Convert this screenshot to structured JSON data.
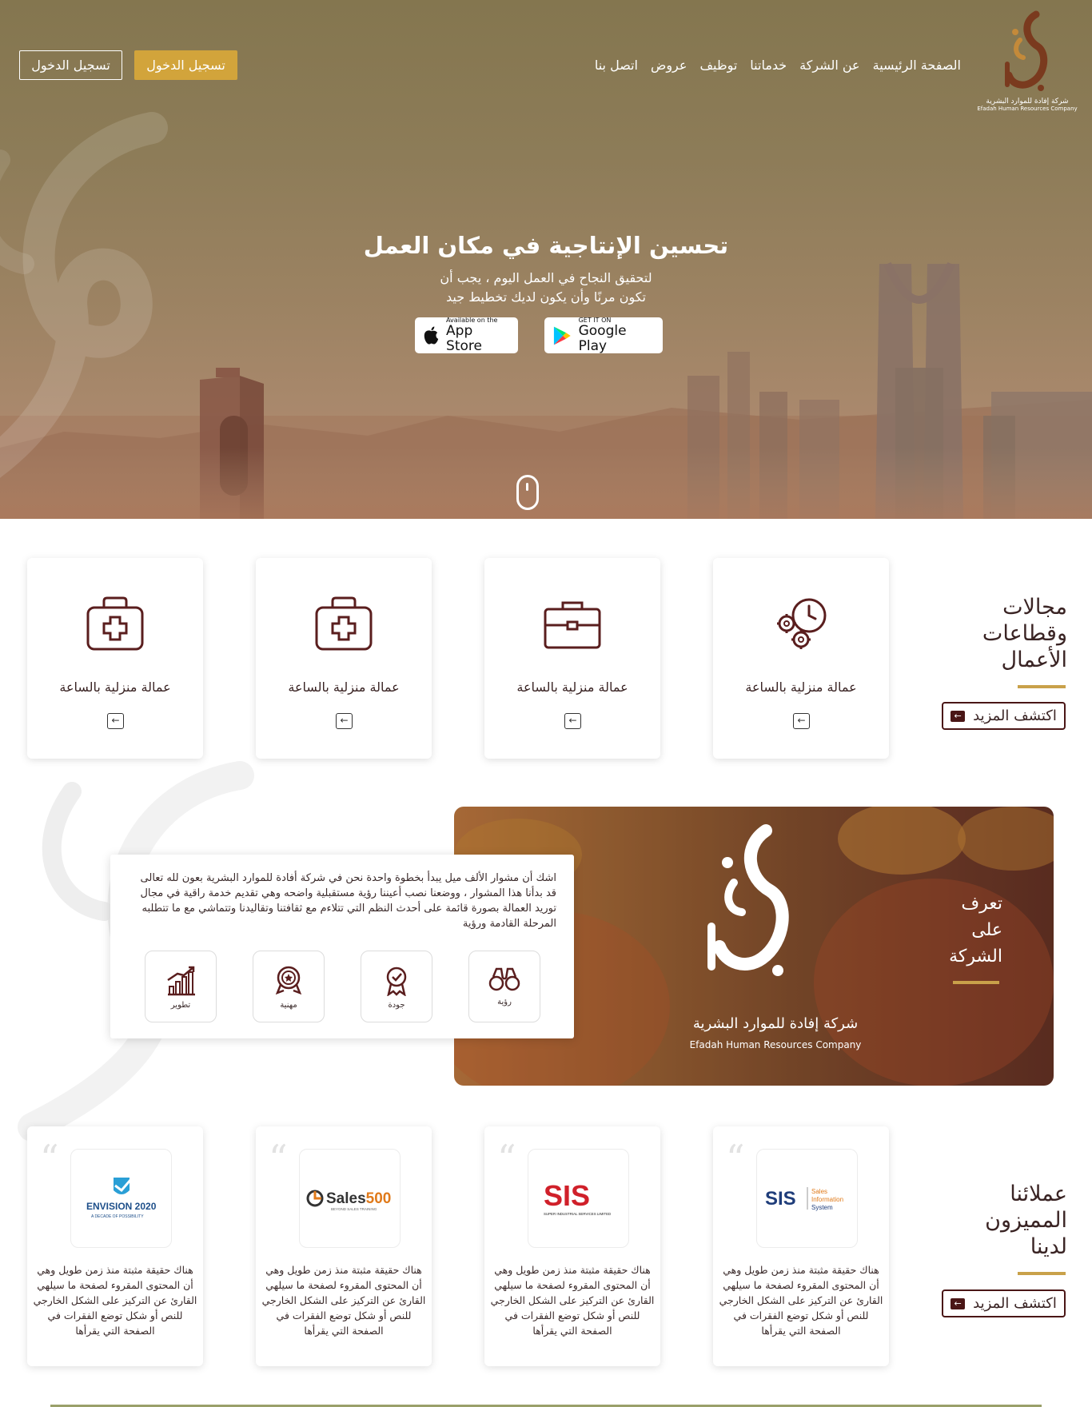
{
  "brand": {
    "logo_mark": "إفادة",
    "name_ar": "شركة إفادة للموارد البشرية",
    "name_en": "Efadah Human Resources Company"
  },
  "nav": {
    "items": [
      "الصفحة الرئيسية",
      "عن الشركة",
      "خدماتنا",
      "توظيف",
      "عروض",
      "اتصل بنا"
    ]
  },
  "auth": {
    "login_primary": "تسجيل الدخول",
    "login_secondary": "تسجيل الدخول"
  },
  "hero": {
    "title": "تحسين الإنتاجية في مكان العمل",
    "subtitle_line1": "لتحقيق النجاح في العمل اليوم ، يجب أن",
    "subtitle_line2": "تكون مرنًا وأن يكون لديك تخطيط جيد",
    "appstore_small": "Available on the",
    "appstore_big": "App Store",
    "googleplay_small": "GET IT ON",
    "googleplay_big": "Google Play"
  },
  "sectors": {
    "title_line1": "مجالات",
    "title_line2": "وقطاعات",
    "title_line3": "الأعمال",
    "more": "اكتشف المزيد",
    "cards": [
      {
        "label": "عمالة منزلية بالساعة",
        "icon": "gears-clock-icon"
      },
      {
        "label": "عمالة منزلية بالساعة",
        "icon": "briefcase-icon"
      },
      {
        "label": "عمالة منزلية بالساعة",
        "icon": "medical-kit-icon"
      },
      {
        "label": "عمالة منزلية بالساعة",
        "icon": "medical-kit-icon"
      }
    ]
  },
  "about": {
    "title_line1": "تعرف",
    "title_line2": "على",
    "title_line3": "الشركة",
    "text": "اشك أن مشوار الألف ميل يبدأ بخطوة واحدة نحن في شركة أفادة للموارد البشرية بعون لله تعالى قد بدأنا هذا المشوار ، ووضعنا نصب أعيننا رؤية مستقبلية واضحه وهي تقديم خدمة راقية في مجال توريد العمالة بصورة قائمة على أحدث النظم التي تتلاءم مع ثقافتنا وتقاليدنا وتتماشي مع ما تتطلبه المرحلة القادمة ورؤية",
    "features": [
      "رؤية",
      "جودة",
      "مهنية",
      "تطوير"
    ]
  },
  "clients": {
    "title_line1": "عملائنا",
    "title_line2": "المميزون",
    "title_line3": "لدينا",
    "more": "اكتشف المزيد",
    "testimonial_text": "هناك حقيقة مثبتة منذ زمن طويل وهي أن المحتوى المقروء لصفحة ما سيلهي القارئ عن التركيز على الشكل الخارجي للنص أو شكل توضع الفقرات في الصفحة التي يقرأها",
    "logos": [
      {
        "name": "SIS",
        "caption": "Sales Information System"
      },
      {
        "name": "SIS",
        "caption": "SUPER INDUSTRIAL SERVICES LIMITED"
      },
      {
        "name": "Sales500",
        "caption": "BEYOND SALES TRAINING"
      },
      {
        "name": "ENVISION 2020",
        "caption": "A DECADE OF POSSIBILITY"
      }
    ]
  },
  "colors": {
    "gold": "#d2a43b",
    "accent_line": "#c9a14a",
    "maroon": "#4a1616"
  }
}
